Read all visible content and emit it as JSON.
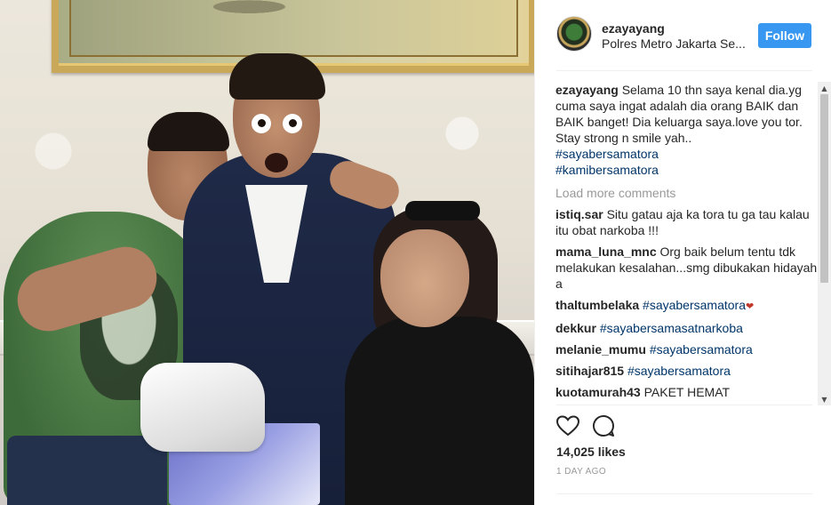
{
  "post": {
    "username": "ezayayang",
    "location": "Polres Metro Jakarta Se...",
    "follow_label": "Follow",
    "caption": {
      "username": "ezayayang",
      "text": "Selama 10 thn saya kenal dia.yg cuma saya ingat adalah dia orang BAIK dan BAIK banget! Dia keluarga saya.love you tor. Stay strong n smile yah..",
      "hashtags": [
        "#sayabersamatora",
        "#kamibersamatora"
      ]
    },
    "load_more_label": "Load more comments",
    "comments": [
      {
        "username": "istiq.sar",
        "text": "Situ gatau aja ka tora tu ga tau kalau itu obat narkoba !!!",
        "tag": ""
      },
      {
        "username": "mama_luna_mnc",
        "text": "Org baik belum tentu tdk melakukan kesalahan...smg dibukakan hidayah a",
        "tag": ""
      },
      {
        "username": "thaltumbelaka",
        "text": "",
        "tag": "#sayabersamatora"
      },
      {
        "username": "dekkur",
        "text": "",
        "tag": "#sayabersamasatnarkoba"
      },
      {
        "username": "melanie_mumu",
        "text": "",
        "tag": "#sayabersamatora"
      },
      {
        "username": "sitihajar815",
        "text": "",
        "tag": "#sayabersamatora"
      },
      {
        "username": "kuotamurah43",
        "text": "PAKET HEMAT",
        "tag": ""
      }
    ],
    "likes": "14,025 likes",
    "time_ago": "1 DAY AGO"
  },
  "icons": {
    "like": "heart-outline-icon",
    "comment": "speech-bubble-icon",
    "avatar": "profile-avatar",
    "scroll_up": "▲",
    "scroll_down": "▼"
  },
  "colors": {
    "follow_button": "#3897f0",
    "hashtag": "#003569",
    "muted": "#999999",
    "text": "#262626"
  }
}
